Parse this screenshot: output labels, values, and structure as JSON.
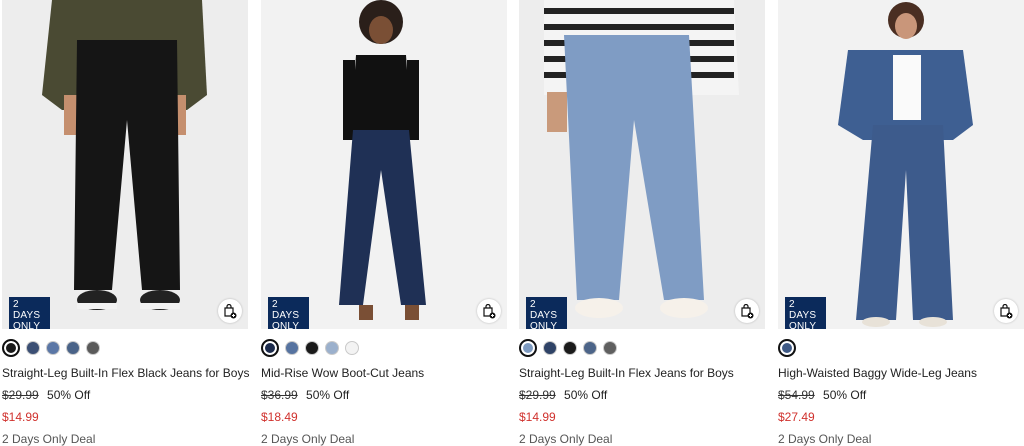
{
  "products": [
    {
      "badge_line1": "2 DAYS",
      "badge_line2": "ONLY",
      "title": "Straight-Leg Built-In Flex Black Jeans for Boys",
      "original_price": "$29.99",
      "discount": "50% Off",
      "sale_price": "$14.99",
      "deal": "2 Days Only Deal",
      "swatches": [
        "#1a1a1a",
        "#3b4f74",
        "#5b77a6",
        "#4a6388",
        "#5a5a5a"
      ],
      "selected_swatch": 0
    },
    {
      "badge_line1": "2 DAYS",
      "badge_line2": "ONLY",
      "title": "Mid-Rise Wow Boot-Cut Jeans",
      "original_price": "$36.99",
      "discount": "50% Off",
      "sale_price": "$18.49",
      "deal": "2 Days Only Deal",
      "swatches": [
        "#1c2b4c",
        "#5673a0",
        "#1a1a1a",
        "#9bb0cc",
        "#f3f3f3"
      ],
      "selected_swatch": 0
    },
    {
      "badge_line1": "2 DAYS",
      "badge_line2": "ONLY",
      "title": "Straight-Leg Built-In Flex Jeans for Boys",
      "original_price": "$29.99",
      "discount": "50% Off",
      "sale_price": "$14.99",
      "deal": "2 Days Only Deal",
      "swatches": [
        "#7d9ac0",
        "#2e4266",
        "#1a1a1a",
        "#4c6488",
        "#5f5f5f"
      ],
      "selected_swatch": 0
    },
    {
      "badge_line1": "2 DAYS",
      "badge_line2": "ONLY",
      "title": "High-Waisted Baggy Wide-Leg Jeans",
      "original_price": "$54.99",
      "discount": "50% Off",
      "sale_price": "$27.49",
      "deal": "2 Days Only Deal",
      "swatches": [
        "#3f5a86"
      ],
      "selected_swatch": 0
    }
  ],
  "colors": {
    "badge": "#0b2a5b",
    "sale": "#d0312d"
  },
  "icons": {
    "bag": "add-to-bag-icon"
  }
}
